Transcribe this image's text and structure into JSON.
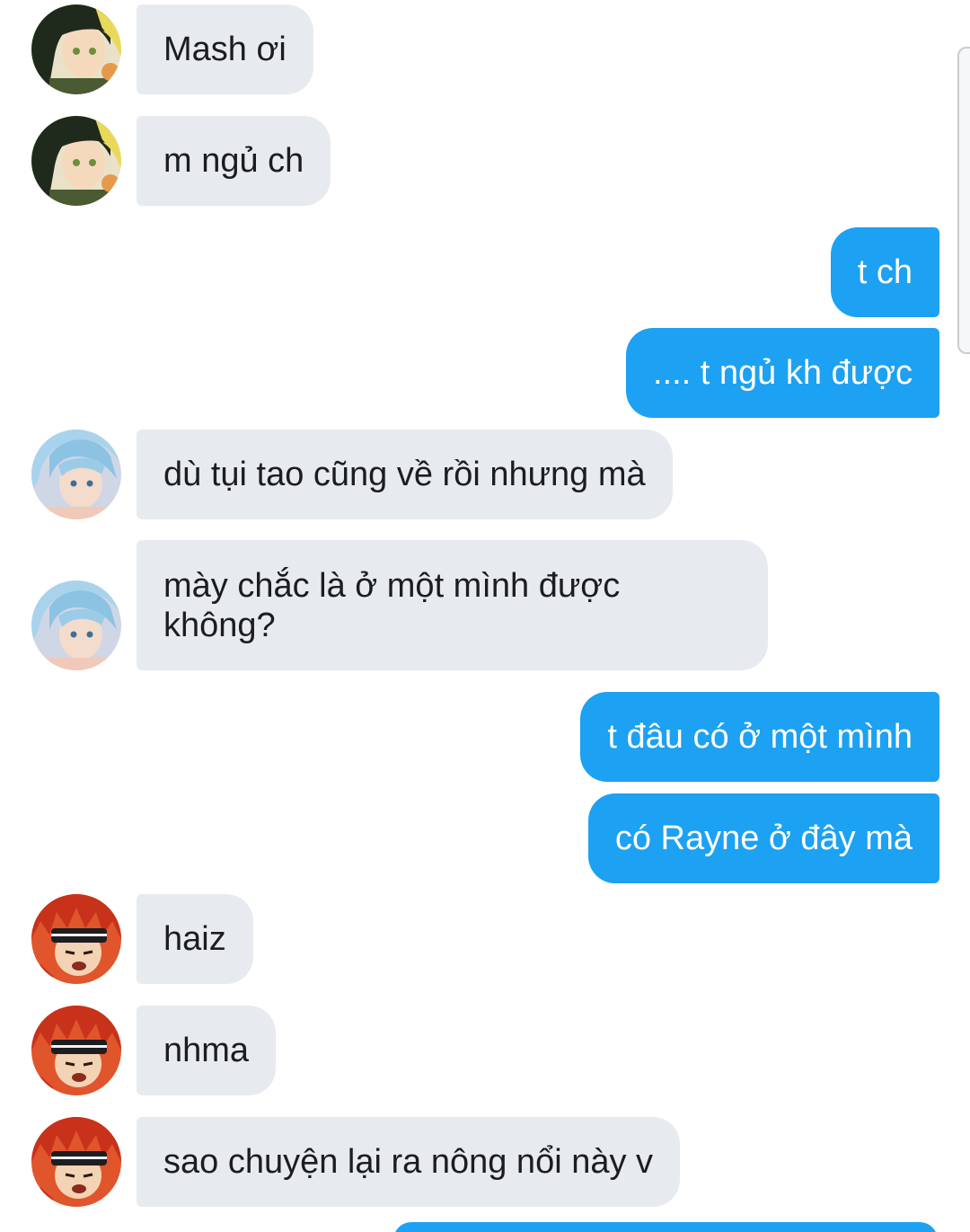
{
  "colors": {
    "incoming_bubble": "#e7ebef",
    "outgoing_bubble": "#1da1f2",
    "incoming_text": "#1b1d20",
    "outgoing_text": "#ffffff"
  },
  "messages": [
    {
      "sender": "avatar-green-haired-character",
      "direction": "incoming",
      "text": "Mash ơi"
    },
    {
      "sender": "avatar-green-haired-character",
      "direction": "incoming",
      "text": "m ngủ ch"
    },
    {
      "sender": "self",
      "direction": "outgoing",
      "text": "t ch"
    },
    {
      "sender": "self",
      "direction": "outgoing",
      "text": ".... t ngủ kh được"
    },
    {
      "sender": "avatar-blue-haired-character",
      "direction": "incoming",
      "text": "dù tụi tao cũng về rồi nhưng mà"
    },
    {
      "sender": "avatar-blue-haired-character",
      "direction": "incoming",
      "text": "mày chắc là ở một mình được không?"
    },
    {
      "sender": "self",
      "direction": "outgoing",
      "text": "t đâu có ở một mình"
    },
    {
      "sender": "self",
      "direction": "outgoing",
      "text": "có Rayne ở đây mà"
    },
    {
      "sender": "avatar-red-haired-character",
      "direction": "incoming",
      "text": "haiz"
    },
    {
      "sender": "avatar-red-haired-character",
      "direction": "incoming",
      "text": "nhma"
    },
    {
      "sender": "avatar-red-haired-character",
      "direction": "incoming",
      "text": "sao chuyện lại ra nông nổi này v"
    }
  ]
}
